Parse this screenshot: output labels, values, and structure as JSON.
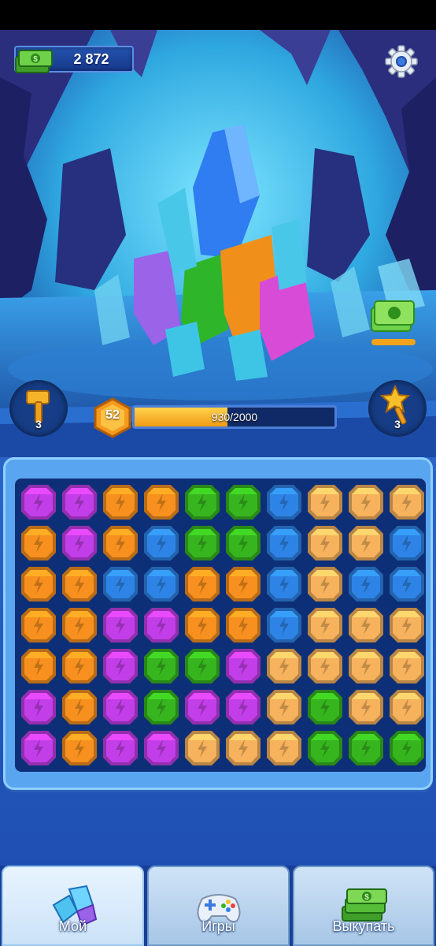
{
  "currency": {
    "value": "2 872",
    "icon": "cash-stack-icon"
  },
  "settings": {
    "icon": "gear-icon"
  },
  "tools": [
    {
      "name": "hammer",
      "icon": "hammer-icon",
      "count": "3"
    },
    {
      "name": "wand",
      "icon": "star-wand-icon",
      "count": "3"
    }
  ],
  "level": {
    "number": "52",
    "progress_text": "930/2000",
    "progress_fraction": 0.465
  },
  "colors": {
    "purple": "#c23ee8",
    "orange": "#f7901e",
    "green": "#37b51f",
    "blue": "#2e84e6",
    "peach": "#f6b25c"
  },
  "board": {
    "rows": [
      [
        "purple",
        "purple",
        "orange",
        "orange",
        "green",
        "green",
        "blue",
        "peach",
        "peach",
        "peach"
      ],
      [
        "orange",
        "purple",
        "orange",
        "blue",
        "green",
        "green",
        "blue",
        "peach",
        "peach",
        "blue"
      ],
      [
        "orange",
        "orange",
        "blue",
        "blue",
        "orange",
        "orange",
        "blue",
        "peach",
        "blue",
        "blue"
      ],
      [
        "orange",
        "orange",
        "purple",
        "purple",
        "orange",
        "orange",
        "blue",
        "peach",
        "peach",
        "peach"
      ],
      [
        "orange",
        "orange",
        "purple",
        "green",
        "green",
        "purple",
        "peach",
        "peach",
        "peach",
        "peach"
      ],
      [
        "purple",
        "orange",
        "purple",
        "green",
        "purple",
        "purple",
        "peach",
        "green",
        "peach",
        "peach"
      ],
      [
        "purple",
        "orange",
        "purple",
        "purple",
        "peach",
        "peach",
        "peach",
        "green",
        "green",
        "green"
      ]
    ]
  },
  "nav": {
    "tabs": [
      {
        "label": "Мой",
        "icon": "crystals-icon",
        "active": true
      },
      {
        "label": "Игры",
        "icon": "gamepad-icon",
        "active": false
      },
      {
        "label": "Выкупать",
        "icon": "cash-stack-icon",
        "active": false
      }
    ]
  }
}
